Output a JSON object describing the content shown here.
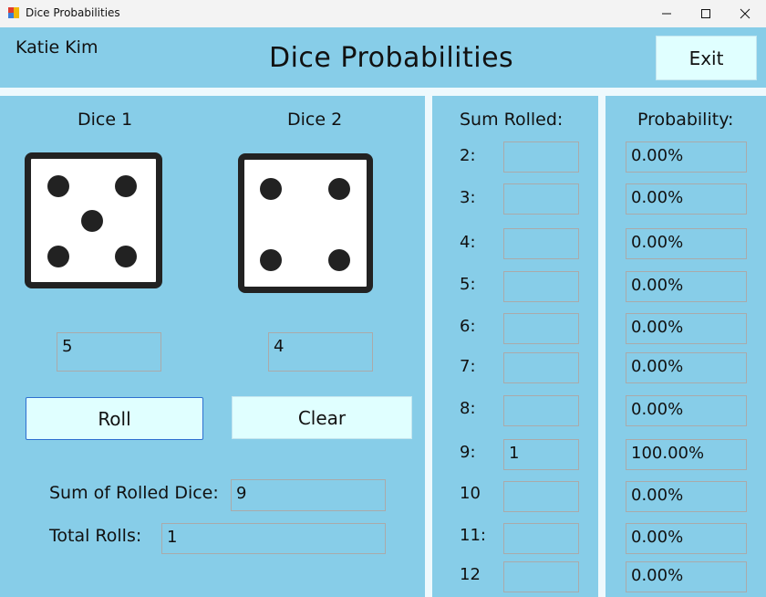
{
  "window": {
    "title": "Dice Probabilities"
  },
  "header": {
    "user_name": "Katie Kim",
    "title": "Dice Probabilities",
    "exit_label": "Exit"
  },
  "dice": {
    "die1_label": "Dice 1",
    "die2_label": "Dice 2",
    "die1_value": "5",
    "die2_value": "4",
    "die1_icon": "dice-five-icon",
    "die2_icon": "dice-four-icon"
  },
  "actions": {
    "roll_label": "Roll",
    "clear_label": "Clear"
  },
  "totals": {
    "sum_label": "Sum of Rolled Dice:",
    "sum_value": "9",
    "rolls_label": "Total Rolls:",
    "rolls_value": "1"
  },
  "results": {
    "sum_header": "Sum Rolled:",
    "prob_header": "Probability:",
    "rows": [
      {
        "label": "2:",
        "count": "",
        "probability": "0.00%"
      },
      {
        "label": "3:",
        "count": "",
        "probability": "0.00%"
      },
      {
        "label": "4:",
        "count": "",
        "probability": "0.00%"
      },
      {
        "label": "5:",
        "count": "",
        "probability": "0.00%"
      },
      {
        "label": "6:",
        "count": "",
        "probability": "0.00%"
      },
      {
        "label": "7:",
        "count": "",
        "probability": "0.00%"
      },
      {
        "label": "8:",
        "count": "",
        "probability": "0.00%"
      },
      {
        "label": "9:",
        "count": "1",
        "probability": "100.00%"
      },
      {
        "label": "10",
        "count": "",
        "probability": "0.00%"
      },
      {
        "label": "11:",
        "count": "",
        "probability": "0.00%"
      },
      {
        "label": "12",
        "count": "",
        "probability": "0.00%"
      }
    ]
  },
  "colors": {
    "background": "#87cde8",
    "divider": "#eef9fd",
    "button": "#e0ffff",
    "roll_border": "#2e6fd0"
  }
}
